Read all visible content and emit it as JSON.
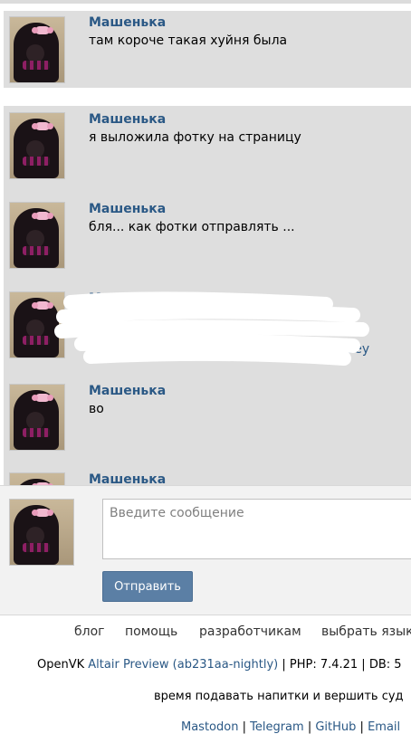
{
  "messages": [
    {
      "author": "Машенька",
      "text": "там короче такая хуйня была"
    },
    {
      "author": "Машенька",
      "text": "я выложила фотку на страницу"
    },
    {
      "author": "Машенька",
      "text": "бля... как фотки отправлять ..."
    },
    {
      "author": "Машенька",
      "text": "ьеу"
    },
    {
      "author": "Машенька",
      "text": "во"
    },
    {
      "author": "Машенька",
      "text": ""
    }
  ],
  "compose": {
    "placeholder": "Введите сообщение",
    "send_label": "Отправить"
  },
  "footer": {
    "links": [
      "блог",
      "помощь",
      "разработчикам",
      "выбрать язык"
    ],
    "version_prefix": "OpenVK ",
    "version_link": "Altair Preview (ab231aa-nightly)",
    "version_suffix": " | PHP: 7.4.21 | DB: 5",
    "tagline": "время подавать напитки и вершить суд",
    "social": [
      "Mastodon",
      "Telegram",
      "GitHub",
      "Email"
    ]
  },
  "colors": {
    "link": "#2a5885",
    "button": "#5b7fa5",
    "message_bg": "#dedede"
  }
}
